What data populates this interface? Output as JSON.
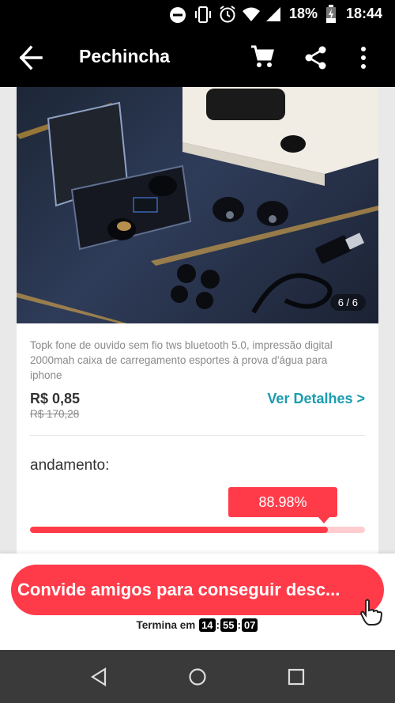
{
  "status_bar": {
    "battery_percent": "18%",
    "time": "18:44"
  },
  "app_bar": {
    "title": "Pechincha"
  },
  "product": {
    "image_counter": "6 / 6",
    "description": "Topk fone de ouvido sem fio tws bluetooth 5.0, impressão digital 2000mah caixa de carregamento esportes à prova d'água para iphone",
    "price": "R$ 0,85",
    "old_price": "R$ 170,28",
    "details_link": "Ver Detalhes >"
  },
  "progress": {
    "label": "andamento:",
    "percent_text": "88.98%",
    "fraction": 0.8898
  },
  "invite": {
    "button_label": "Convide amigos para conseguir desc...",
    "timer_label": "Termina em",
    "hours": "14",
    "minutes": "55",
    "seconds": "07"
  },
  "colors": {
    "accent_red": "#ff3b4a",
    "link_teal": "#1a9cb0"
  }
}
